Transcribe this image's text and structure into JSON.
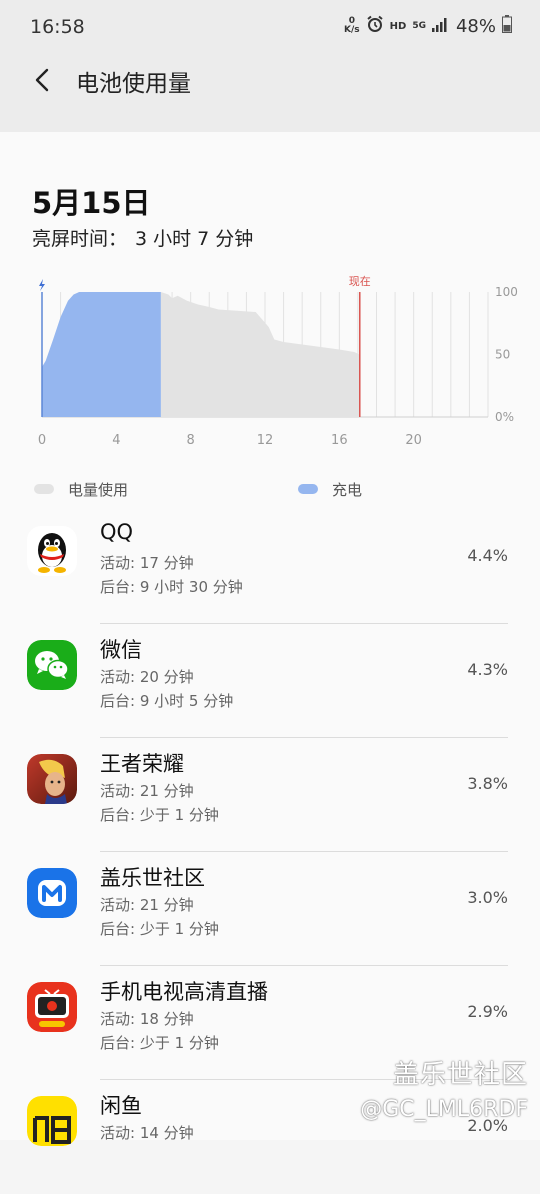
{
  "status_bar": {
    "time": "16:58",
    "net_speed_value": "0",
    "net_speed_unit": "K/s",
    "hd": "HD",
    "network": "5G",
    "battery": "48%"
  },
  "header": {
    "title": "电池使用量"
  },
  "summary": {
    "date": "5月15日",
    "screen_time_label": "亮屏时间：",
    "screen_time_value": "3 小时 7 分钟"
  },
  "chart_data": {
    "type": "area",
    "x_ticks": [
      "0",
      "4",
      "8",
      "12",
      "16",
      "20"
    ],
    "y_ticks": [
      "100",
      "50",
      "0%"
    ],
    "xlim": [
      0,
      24
    ],
    "ylim": [
      0,
      100
    ],
    "now_label": "现在",
    "now_x": 17.1,
    "series": [
      {
        "name": "充电",
        "color": "#95b6ef",
        "x": [
          0,
          0.2,
          0.6,
          1.0,
          1.4,
          1.7,
          2.0,
          3.0,
          4.0,
          5.0,
          6.0,
          6.4
        ],
        "y": [
          40,
          45,
          62,
          80,
          93,
          98,
          100,
          100,
          100,
          100,
          100,
          100
        ]
      },
      {
        "name": "电量使用",
        "color": "#e3e3e3",
        "x": [
          6.4,
          6.8,
          7.0,
          7.3,
          7.8,
          8.4,
          9.0,
          9.5,
          10.5,
          11.5,
          12.2,
          12.5,
          13.0,
          14.0,
          15.0,
          16.0,
          16.8,
          17.1
        ],
        "y": [
          100,
          98,
          95,
          97,
          93,
          90,
          88,
          86,
          85,
          84,
          72,
          62,
          60,
          58,
          56,
          54,
          52,
          50
        ]
      }
    ]
  },
  "legend": {
    "usage": "电量使用",
    "charging": "充电",
    "usage_color": "#e3e3e3",
    "charging_color": "#95b6ef"
  },
  "apps": [
    {
      "name": "QQ",
      "active": "活动: 17 分钟",
      "background": "后台: 9 小时 30 分钟",
      "percent": "4.4%",
      "icon": "qq-icon"
    },
    {
      "name": "微信",
      "active": "活动: 20 分钟",
      "background": "后台: 9 小时 5 分钟",
      "percent": "4.3%",
      "icon": "wechat-icon"
    },
    {
      "name": "王者荣耀",
      "active": "活动: 21 分钟",
      "background": "后台: 少于 1 分钟",
      "percent": "3.8%",
      "icon": "honor-of-kings-icon"
    },
    {
      "name": "盖乐世社区",
      "active": "活动: 21 分钟",
      "background": "后台: 少于 1 分钟",
      "percent": "3.0%",
      "icon": "galaxy-community-icon"
    },
    {
      "name": "手机电视高清直播",
      "active": "活动: 18 分钟",
      "background": "后台: 少于 1 分钟",
      "percent": "2.9%",
      "icon": "mobile-tv-icon"
    },
    {
      "name": "闲鱼",
      "active": "活动: 14 分钟",
      "background": "",
      "percent": "2.0%",
      "icon": "xianyu-icon"
    }
  ],
  "watermark": {
    "line1": "盖乐世社区",
    "line2": "@GC_LML6RDF"
  }
}
